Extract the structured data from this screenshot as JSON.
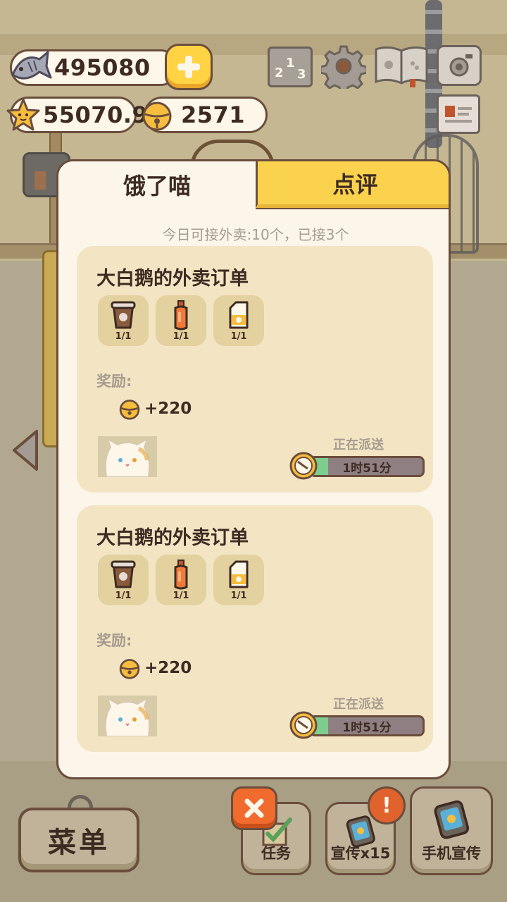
{
  "hud": {
    "fish_count": "495080",
    "star_count": "55070.9",
    "bell_count": "2571"
  },
  "tabs": [
    {
      "label": "饿了喵",
      "active": true
    },
    {
      "label": "点评",
      "active": false
    }
  ],
  "quota_text": "今日可接外卖:10个，已接3个",
  "orders": [
    {
      "title": "大白鹅的外卖订单",
      "items": [
        {
          "icon": "cup-drink-icon",
          "count": "1/1"
        },
        {
          "icon": "juice-bottle-icon",
          "count": "1/1"
        },
        {
          "icon": "milk-carton-icon",
          "count": "1/1"
        }
      ],
      "reward_label": "奖励:",
      "reward_value": "+220",
      "status": "正在派送",
      "time_left": "1时51分",
      "progress": 0.15
    },
    {
      "title": "大白鹅的外卖订单",
      "items": [
        {
          "icon": "cup-drink-icon",
          "count": "1/1"
        },
        {
          "icon": "juice-bottle-icon",
          "count": "1/1"
        },
        {
          "icon": "milk-carton-icon",
          "count": "1/1"
        }
      ],
      "reward_label": "奖励:",
      "reward_value": "+220",
      "status": "正在派送",
      "time_left": "1时51分",
      "progress": 0.15
    }
  ],
  "bottom": {
    "menu_label": "菜单",
    "task_label": "任务",
    "promo_label": "宣传x15",
    "phone_promo_label": "手机宣传",
    "alert_symbol": "!"
  },
  "colors": {
    "accent_yellow": "#fbd24d",
    "panel_bg": "#fcf6ea",
    "card_bg": "#f3e5c4",
    "outline": "#6b4d3c",
    "close_orange": "#f06b2d",
    "progress_green": "#7dcd8e"
  }
}
